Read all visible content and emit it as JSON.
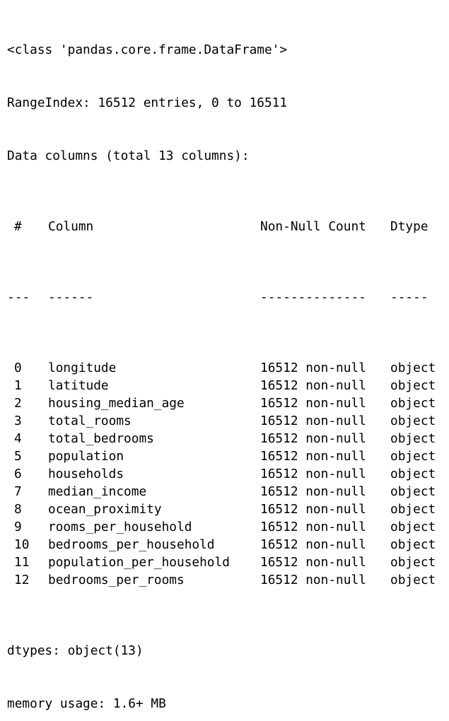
{
  "header": {
    "class_line": "<class 'pandas.core.frame.DataFrame'>",
    "range_index": "RangeIndex: 16512 entries, 0 to 16511",
    "data_columns": "Data columns (total 13 columns):"
  },
  "table": {
    "headers": {
      "idx": "#",
      "column": "Column",
      "non_null": "Non-Null Count",
      "dtype": "Dtype"
    },
    "separators": {
      "idx": "---",
      "column": "------",
      "non_null": "--------------",
      "dtype": "-----"
    },
    "rows": [
      {
        "idx": "0",
        "column": "longitude",
        "non_null": "16512 non-null",
        "dtype": "object"
      },
      {
        "idx": "1",
        "column": "latitude",
        "non_null": "16512 non-null",
        "dtype": "object"
      },
      {
        "idx": "2",
        "column": "housing_median_age",
        "non_null": "16512 non-null",
        "dtype": "object"
      },
      {
        "idx": "3",
        "column": "total_rooms",
        "non_null": "16512 non-null",
        "dtype": "object"
      },
      {
        "idx": "4",
        "column": "total_bedrooms",
        "non_null": "16512 non-null",
        "dtype": "object"
      },
      {
        "idx": "5",
        "column": "population",
        "non_null": "16512 non-null",
        "dtype": "object"
      },
      {
        "idx": "6",
        "column": "households",
        "non_null": "16512 non-null",
        "dtype": "object"
      },
      {
        "idx": "7",
        "column": "median_income",
        "non_null": "16512 non-null",
        "dtype": "object"
      },
      {
        "idx": "8",
        "column": "ocean_proximity",
        "non_null": "16512 non-null",
        "dtype": "object"
      },
      {
        "idx": "9",
        "column": "rooms_per_household",
        "non_null": "16512 non-null",
        "dtype": "object"
      },
      {
        "idx": "10",
        "column": "bedrooms_per_household",
        "non_null": "16512 non-null",
        "dtype": "object"
      },
      {
        "idx": "11",
        "column": "population_per_household",
        "non_null": "16512 non-null",
        "dtype": "object"
      },
      {
        "idx": "12",
        "column": "bedrooms_per_rooms",
        "non_null": "16512 non-null",
        "dtype": "object"
      }
    ]
  },
  "footer": {
    "dtypes": "dtypes: object(13)",
    "memory": "memory usage: 1.6+ MB"
  }
}
